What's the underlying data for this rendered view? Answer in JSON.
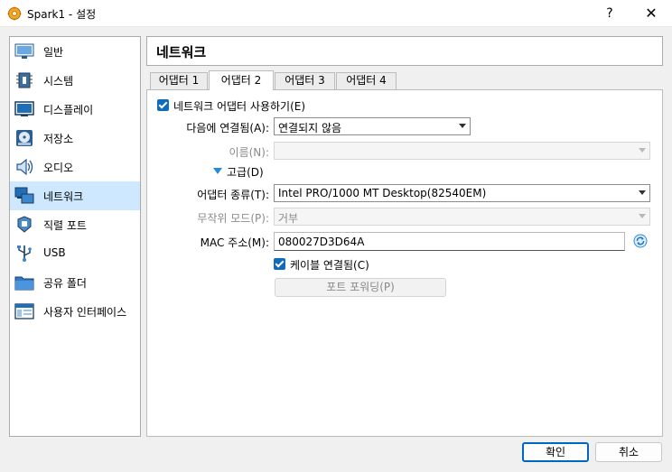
{
  "window": {
    "title": "Spark1 - 설정",
    "help_label": "?",
    "close_label": "✕"
  },
  "sidebar": {
    "items": [
      {
        "label": "일반",
        "icon": "monitor-icon"
      },
      {
        "label": "시스템",
        "icon": "chip-icon"
      },
      {
        "label": "디스플레이",
        "icon": "display-icon"
      },
      {
        "label": "저장소",
        "icon": "disk-icon"
      },
      {
        "label": "오디오",
        "icon": "speaker-icon"
      },
      {
        "label": "네트워크",
        "icon": "network-icon",
        "selected": true
      },
      {
        "label": "직렬 포트",
        "icon": "serial-port-icon"
      },
      {
        "label": "USB",
        "icon": "usb-icon"
      },
      {
        "label": "공유 폴더",
        "icon": "folder-icon"
      },
      {
        "label": "사용자 인터페이스",
        "icon": "ui-icon"
      }
    ]
  },
  "header": {
    "title": "네트워크"
  },
  "tabs": [
    {
      "label": "어댑터 1",
      "active": false
    },
    {
      "label": "어댑터 2",
      "active": true
    },
    {
      "label": "어댑터 3",
      "active": false
    },
    {
      "label": "어댑터 4",
      "active": false
    }
  ],
  "form": {
    "enable_label": "네트워크 어댑터 사용하기(E)",
    "enable_checked": true,
    "attached_label": "다음에 연결됨(A):",
    "attached_value": "연결되지 않음",
    "name_label": "이름(N):",
    "name_value": "",
    "advanced_label": "고급(D)",
    "adapter_type_label": "어댑터 종류(T):",
    "adapter_type_value": "Intel PRO/1000 MT Desktop(82540EM)",
    "promisc_label": "무작위 모드(P):",
    "promisc_value": "거부",
    "mac_label": "MAC 주소(M):",
    "mac_value": "080027D3D64A",
    "cable_label": "케이블 연결됨(C)",
    "cable_checked": true,
    "port_forward_label": "포트 포워딩(P)"
  },
  "buttons": {
    "ok": "확인",
    "cancel": "취소"
  },
  "colors": {
    "accent": "#0f6cbd",
    "selection": "#cde8ff"
  }
}
